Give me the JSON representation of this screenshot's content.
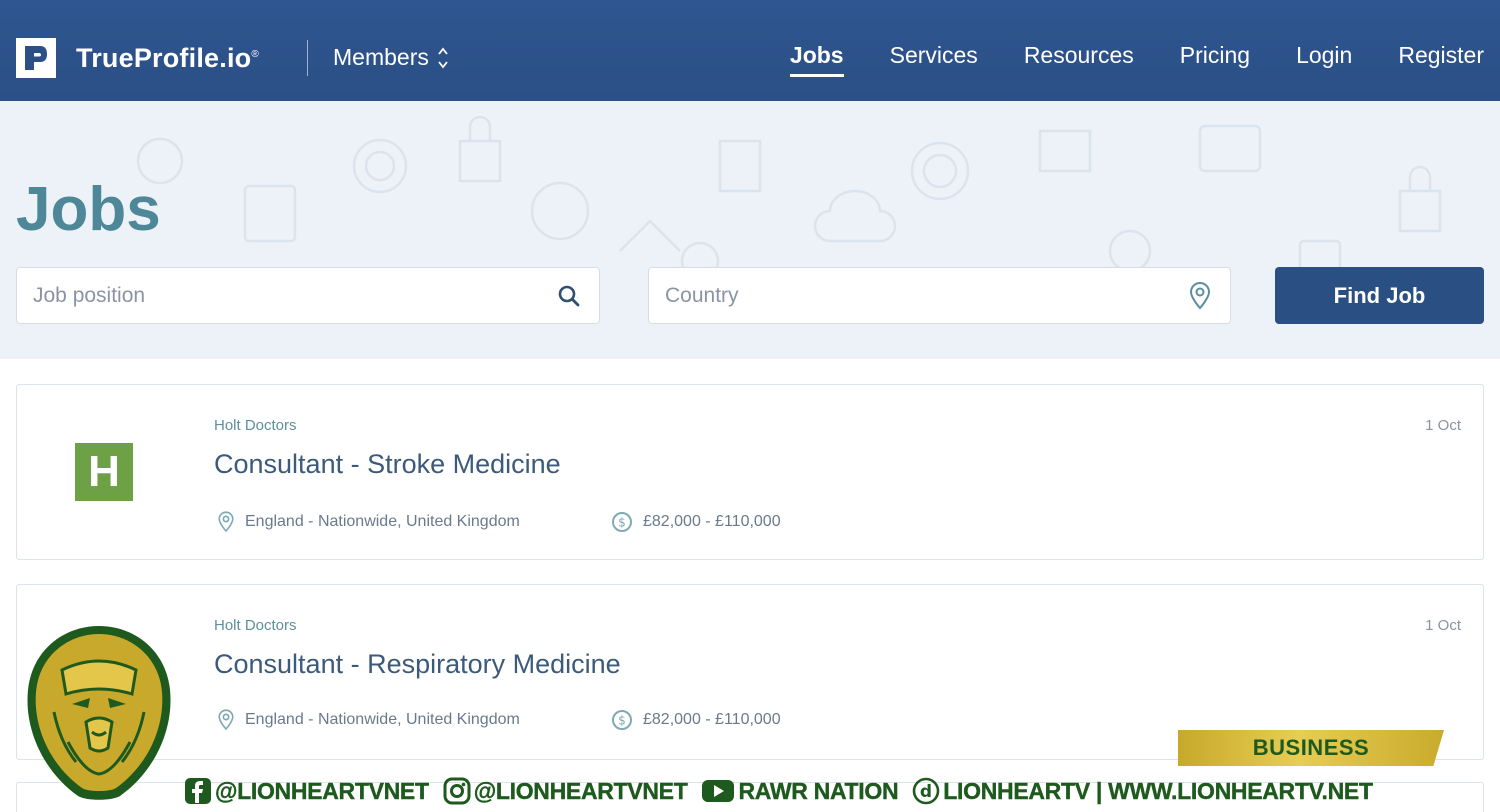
{
  "nav": {
    "brand": "TrueProfile.io",
    "brand_mark": "®",
    "members": "Members",
    "links": [
      "Jobs",
      "Services",
      "Resources",
      "Pricing",
      "Login",
      "Register"
    ],
    "active": "Jobs"
  },
  "hero": {
    "title": "Jobs",
    "job_placeholder": "Job position",
    "country_placeholder": "Country",
    "find_button": "Find Job"
  },
  "jobs": [
    {
      "company": "Holt Doctors",
      "title": "Consultant - Stroke Medicine",
      "date": "1 Oct",
      "location": "England - Nationwide, United Kingdom",
      "salary": "£82,000 - £110,000",
      "logo_letter": "H"
    },
    {
      "company": "Holt Doctors",
      "title": "Consultant - Respiratory Medicine",
      "date": "1 Oct",
      "location": "England - Nationwide, United Kingdom",
      "salary": "£82,000 - £110,000"
    }
  ],
  "watermark": {
    "category": "BUSINESS",
    "facebook": "@LIONHEARTVNET",
    "instagram": "@LIONHEARTVNET",
    "youtube": "RAWR NATION",
    "site": "LIONHEARTV | WWW.LIONHEARTV.NET"
  },
  "colors": {
    "nav_bg": "#2b4f86",
    "hero_bg": "#edf2f8",
    "title_teal": "#4e8797",
    "button": "#2a4f83",
    "logo_green": "#6ea046",
    "watermark_green": "#1e5a1e",
    "ribbon_gold": "#d9bd3e"
  },
  "icons": [
    "brand-logo-icon",
    "chevron-updown-icon",
    "search-icon",
    "location-pin-icon",
    "dollar-circle-icon",
    "facebook-icon",
    "instagram-icon",
    "youtube-icon",
    "dailymotion-icon",
    "lion-logo-icon"
  ]
}
